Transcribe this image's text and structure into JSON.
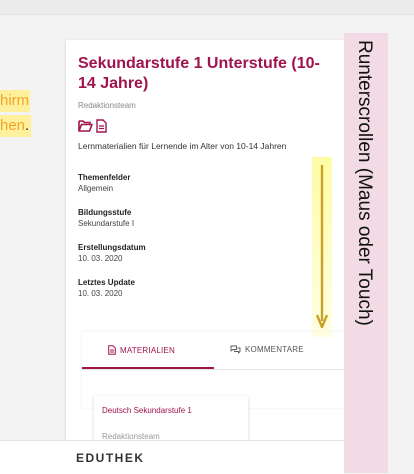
{
  "annotations": {
    "left_line1": "hirm",
    "left_line2": "hen",
    "left_dot": ".",
    "scroll_hint": "Runterscrollen (Maus oder Touch)"
  },
  "card": {
    "title": "Sekundarstufe 1 Unterstufe (10-14 Jahre)",
    "author": "Redaktionsteam",
    "description": "Lernmaterialien für Lernende im Alter von 10-14 Jahren",
    "meta": [
      {
        "label": "Themenfelder",
        "value": "Allgemein"
      },
      {
        "label": "Bildungsstufe",
        "value": "Sekundarstufe I"
      },
      {
        "label": "Erstellungsdatum",
        "value": "10. 03. 2020"
      },
      {
        "label": "Letztes Update",
        "value": "10. 03. 2020"
      }
    ],
    "tabs": [
      {
        "label": "MATERIALIEN",
        "active": true
      },
      {
        "label": "KOMMENTARE",
        "active": false
      }
    ],
    "material": {
      "title": "Deutsch Sekundarstufe 1",
      "author": "Redaktionsteam"
    }
  },
  "footer": {
    "logo": "EDUTHEK"
  },
  "colors": {
    "accent": "#a0144d",
    "highlight": "#fff19c",
    "arrow": "#c9a227",
    "side_panel": "#f2dbe4"
  }
}
